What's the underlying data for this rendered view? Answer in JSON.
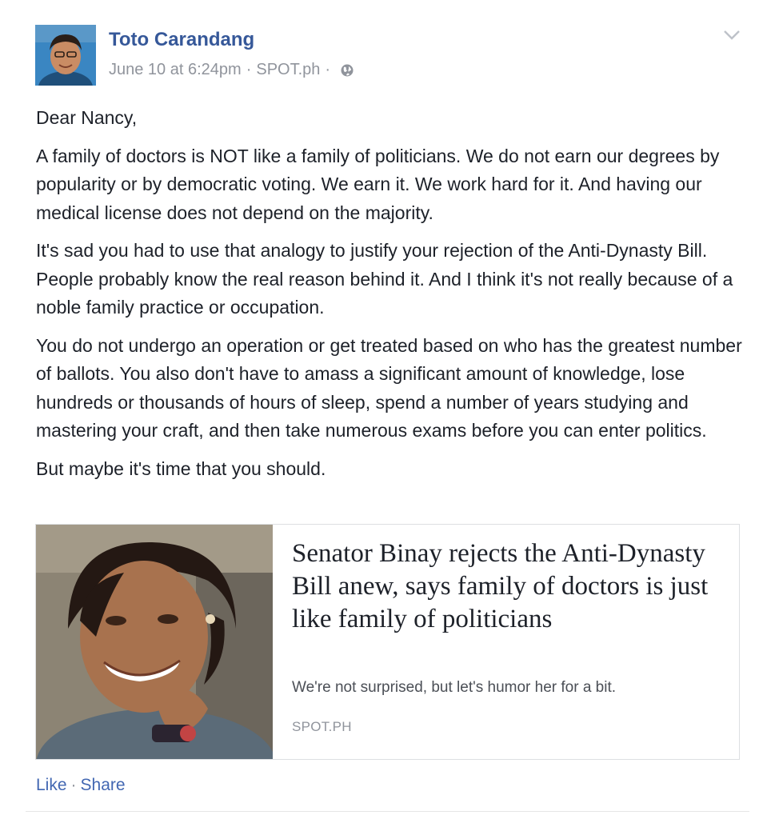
{
  "post": {
    "author": "Toto Carandang",
    "timestamp": "June 10 at 6:24pm",
    "via": "SPOT.ph",
    "separator": "·",
    "privacy_icon": "globe-icon",
    "options_icon": "chevron-down-icon",
    "paragraphs": [
      "Dear Nancy,",
      "A family of doctors is NOT like a family of politicians. We do not earn our degrees by popularity or by democratic voting. We earn it. We work hard for it. And having our medical license does not depend on the majority.",
      "It's sad you had to use that analogy to justify your rejection of the Anti-Dynasty Bill. People probably know the real reason behind it. And I think it's not really because of a noble family practice or occupation.",
      "You do not undergo an operation or get treated based on who has the greatest number of ballots. You also don't have to amass a significant amount of knowledge, lose hundreds or thousands of hours of sleep, spend a number of years studying and mastering your craft, and then take numerous exams before you can enter politics.",
      "But maybe it's time that you should."
    ]
  },
  "link_preview": {
    "title": "Senator Binay rejects the Anti-Dynasty Bill anew, says family of doctors is just like family of politicians",
    "description": "We're not surprised, but let's humor her for a bit.",
    "domain": "SPOT.PH"
  },
  "actions": {
    "like_label": "Like",
    "separator": "·",
    "share_label": "Share"
  },
  "colors": {
    "author_link": "#365899",
    "action_link": "#4267b2",
    "meta_text": "#90949c",
    "body_text": "#1d2129",
    "card_border": "#dddfe2"
  }
}
